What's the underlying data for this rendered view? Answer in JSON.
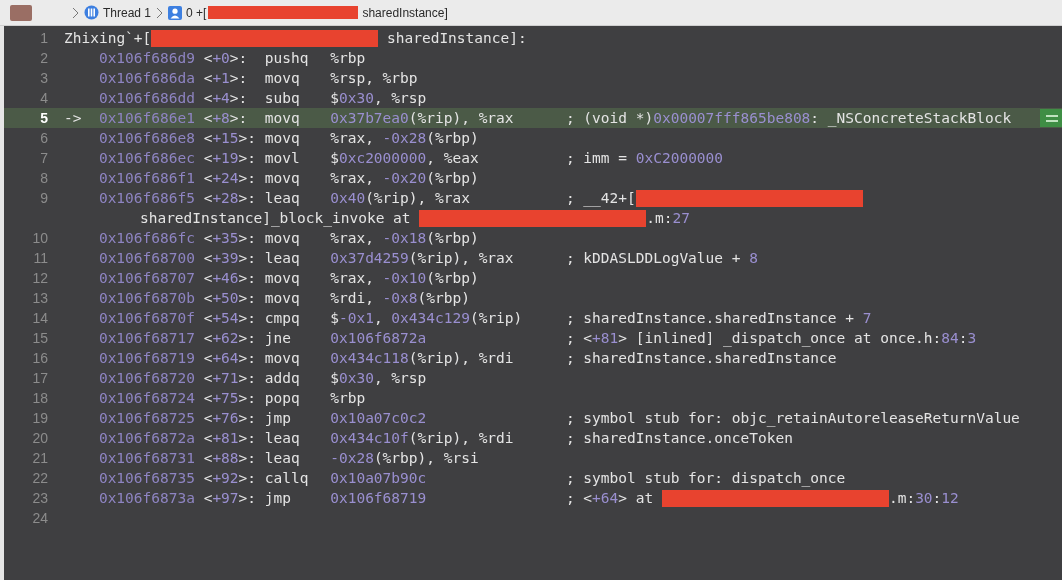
{
  "breadcrumb": {
    "thread": "Thread 1",
    "frame": [
      {
        "kind": "text",
        "text": "0 +["
      },
      {
        "kind": "redaction"
      },
      {
        "kind": "text",
        "text": "sharedInstance]"
      }
    ]
  },
  "lines": [
    {
      "number": "1",
      "kind": "label",
      "current": false,
      "parts": [
        {
          "kind": "text",
          "text": "Zhixing`+["
        },
        {
          "kind": "redaction"
        },
        {
          "kind": "text",
          "text": " sharedInstance]:"
        }
      ]
    },
    {
      "number": "2",
      "kind": "instruction",
      "current": false,
      "address": "0x106f686d9",
      "offset": "<+0>:",
      "mnemonic": "pushq",
      "operands": "%rbp"
    },
    {
      "number": "3",
      "kind": "instruction",
      "current": false,
      "address": "0x106f686da",
      "offset": "<+1>:",
      "mnemonic": "movq",
      "operands": "%rsp, %rbp"
    },
    {
      "number": "4",
      "kind": "instruction",
      "current": false,
      "address": "0x106f686dd",
      "offset": "<+4>:",
      "mnemonic": "subq",
      "operands": "$0x30, %rsp"
    },
    {
      "number": "5",
      "kind": "instruction",
      "current": true,
      "pointer": "->",
      "address": "0x106f686e1",
      "offset": "<+8>:",
      "mnemonic": "movq",
      "operands": "0x37b7ea0(%rip), %rax",
      "comment": [
        {
          "kind": "text",
          "text": "; (void *)0x00007fff865be808: _NSConcreteStackBlock"
        }
      ]
    },
    {
      "number": "6",
      "kind": "instruction",
      "current": false,
      "address": "0x106f686e8",
      "offset": "<+15>:",
      "mnemonic": "movq",
      "operands": "%rax, -0x28(%rbp)"
    },
    {
      "number": "7",
      "kind": "instruction",
      "current": false,
      "address": "0x106f686ec",
      "offset": "<+19>:",
      "mnemonic": "movl",
      "operands": "$0xc2000000, %eax",
      "comment": [
        {
          "kind": "text",
          "text": "; imm = 0xC2000000"
        }
      ]
    },
    {
      "number": "8",
      "kind": "instruction",
      "current": false,
      "address": "0x106f686f1",
      "offset": "<+24>:",
      "mnemonic": "movq",
      "operands": "%rax, -0x20(%rbp)"
    },
    {
      "number": "9",
      "kind": "instruction",
      "current": false,
      "address": "0x106f686f5",
      "offset": "<+28>:",
      "mnemonic": "leaq",
      "operands": "0x40(%rip), %rax",
      "comment": [
        {
          "kind": "text",
          "text": "; __42+["
        },
        {
          "kind": "redaction"
        }
      ],
      "continuation": [
        {
          "kind": "text",
          "text": "sharedInstance]_block_invoke at "
        },
        {
          "kind": "redaction"
        },
        {
          "kind": "text",
          "text": ".m:27"
        }
      ]
    },
    {
      "number": "10",
      "kind": "instruction",
      "current": false,
      "address": "0x106f686fc",
      "offset": "<+35>:",
      "mnemonic": "movq",
      "operands": "%rax, -0x18(%rbp)"
    },
    {
      "number": "11",
      "kind": "instruction",
      "current": false,
      "address": "0x106f68700",
      "offset": "<+39>:",
      "mnemonic": "leaq",
      "operands": "0x37d4259(%rip), %rax",
      "comment": [
        {
          "kind": "text",
          "text": "; kDDASLDDLogValue + 8"
        }
      ]
    },
    {
      "number": "12",
      "kind": "instruction",
      "current": false,
      "address": "0x106f68707",
      "offset": "<+46>:",
      "mnemonic": "movq",
      "operands": "%rax, -0x10(%rbp)"
    },
    {
      "number": "13",
      "kind": "instruction",
      "current": false,
      "address": "0x106f6870b",
      "offset": "<+50>:",
      "mnemonic": "movq",
      "operands": "%rdi, -0x8(%rbp)"
    },
    {
      "number": "14",
      "kind": "instruction",
      "current": false,
      "address": "0x106f6870f",
      "offset": "<+54>:",
      "mnemonic": "cmpq",
      "operands": "$-0x1, 0x434c129(%rip)",
      "comment": [
        {
          "kind": "text",
          "text": "; sharedInstance.sharedInstance + 7"
        }
      ]
    },
    {
      "number": "15",
      "kind": "instruction",
      "current": false,
      "address": "0x106f68717",
      "offset": "<+62>:",
      "mnemonic": "jne",
      "operands": "0x106f6872a",
      "comment": [
        {
          "kind": "text",
          "text": "; <+81> [inlined] _dispatch_once at once.h:84:3"
        }
      ]
    },
    {
      "number": "16",
      "kind": "instruction",
      "current": false,
      "address": "0x106f68719",
      "offset": "<+64>:",
      "mnemonic": "movq",
      "operands": "0x434c118(%rip), %rdi",
      "comment": [
        {
          "kind": "text",
          "text": "; sharedInstance.sharedInstance"
        }
      ]
    },
    {
      "number": "17",
      "kind": "instruction",
      "current": false,
      "address": "0x106f68720",
      "offset": "<+71>:",
      "mnemonic": "addq",
      "operands": "$0x30, %rsp"
    },
    {
      "number": "18",
      "kind": "instruction",
      "current": false,
      "address": "0x106f68724",
      "offset": "<+75>:",
      "mnemonic": "popq",
      "operands": "%rbp"
    },
    {
      "number": "19",
      "kind": "instruction",
      "current": false,
      "address": "0x106f68725",
      "offset": "<+76>:",
      "mnemonic": "jmp",
      "operands": "0x10a07c0c2",
      "comment": [
        {
          "kind": "text",
          "text": "; symbol stub for: objc_retainAutoreleaseReturnValue"
        }
      ]
    },
    {
      "number": "20",
      "kind": "instruction",
      "current": false,
      "address": "0x106f6872a",
      "offset": "<+81>:",
      "mnemonic": "leaq",
      "operands": "0x434c10f(%rip), %rdi",
      "comment": [
        {
          "kind": "text",
          "text": "; sharedInstance.onceToken"
        }
      ]
    },
    {
      "number": "21",
      "kind": "instruction",
      "current": false,
      "address": "0x106f68731",
      "offset": "<+88>:",
      "mnemonic": "leaq",
      "operands": "-0x28(%rbp), %rsi"
    },
    {
      "number": "22",
      "kind": "instruction",
      "current": false,
      "address": "0x106f68735",
      "offset": "<+92>:",
      "mnemonic": "callq",
      "operands": "0x10a07b90c",
      "comment": [
        {
          "kind": "text",
          "text": "; symbol stub for: dispatch_once"
        }
      ]
    },
    {
      "number": "23",
      "kind": "instruction",
      "current": false,
      "address": "0x106f6873a",
      "offset": "<+97>:",
      "mnemonic": "jmp",
      "operands": "0x106f68719",
      "comment": [
        {
          "kind": "text",
          "text": "; <+64> at "
        },
        {
          "kind": "redaction"
        },
        {
          "kind": "text",
          "text": ".m:30:12"
        }
      ]
    },
    {
      "number": "24",
      "kind": "empty",
      "current": false
    }
  ]
}
